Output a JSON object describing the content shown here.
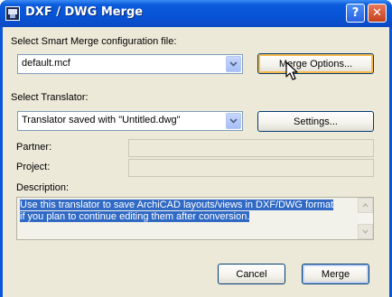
{
  "window": {
    "title": "DXF / DWG Merge",
    "help_glyph": "?",
    "close_glyph": "✕"
  },
  "merge_config": {
    "label": "Select Smart Merge configuration file:",
    "selected": "default.mcf",
    "options_button": "Merge Options..."
  },
  "translator": {
    "label": "Select Translator:",
    "selected": "Translator saved with \"Untitled.dwg\"",
    "settings_button": "Settings..."
  },
  "partner": {
    "label": "Partner:",
    "value": ""
  },
  "project": {
    "label": "Project:",
    "value": ""
  },
  "description": {
    "label": "Description:",
    "line1": "Use this translator to save ArchiCAD layouts/views in DXF/DWG format",
    "line2": "if you plan to continue editing them after conversion."
  },
  "footer": {
    "cancel_button": "Cancel",
    "merge_button": "Merge"
  },
  "colors": {
    "titlebar": "#0a56d8",
    "dialog_bg": "#ece9d8",
    "selection": "#316ac5",
    "focus_ring": "#f8b94a"
  }
}
